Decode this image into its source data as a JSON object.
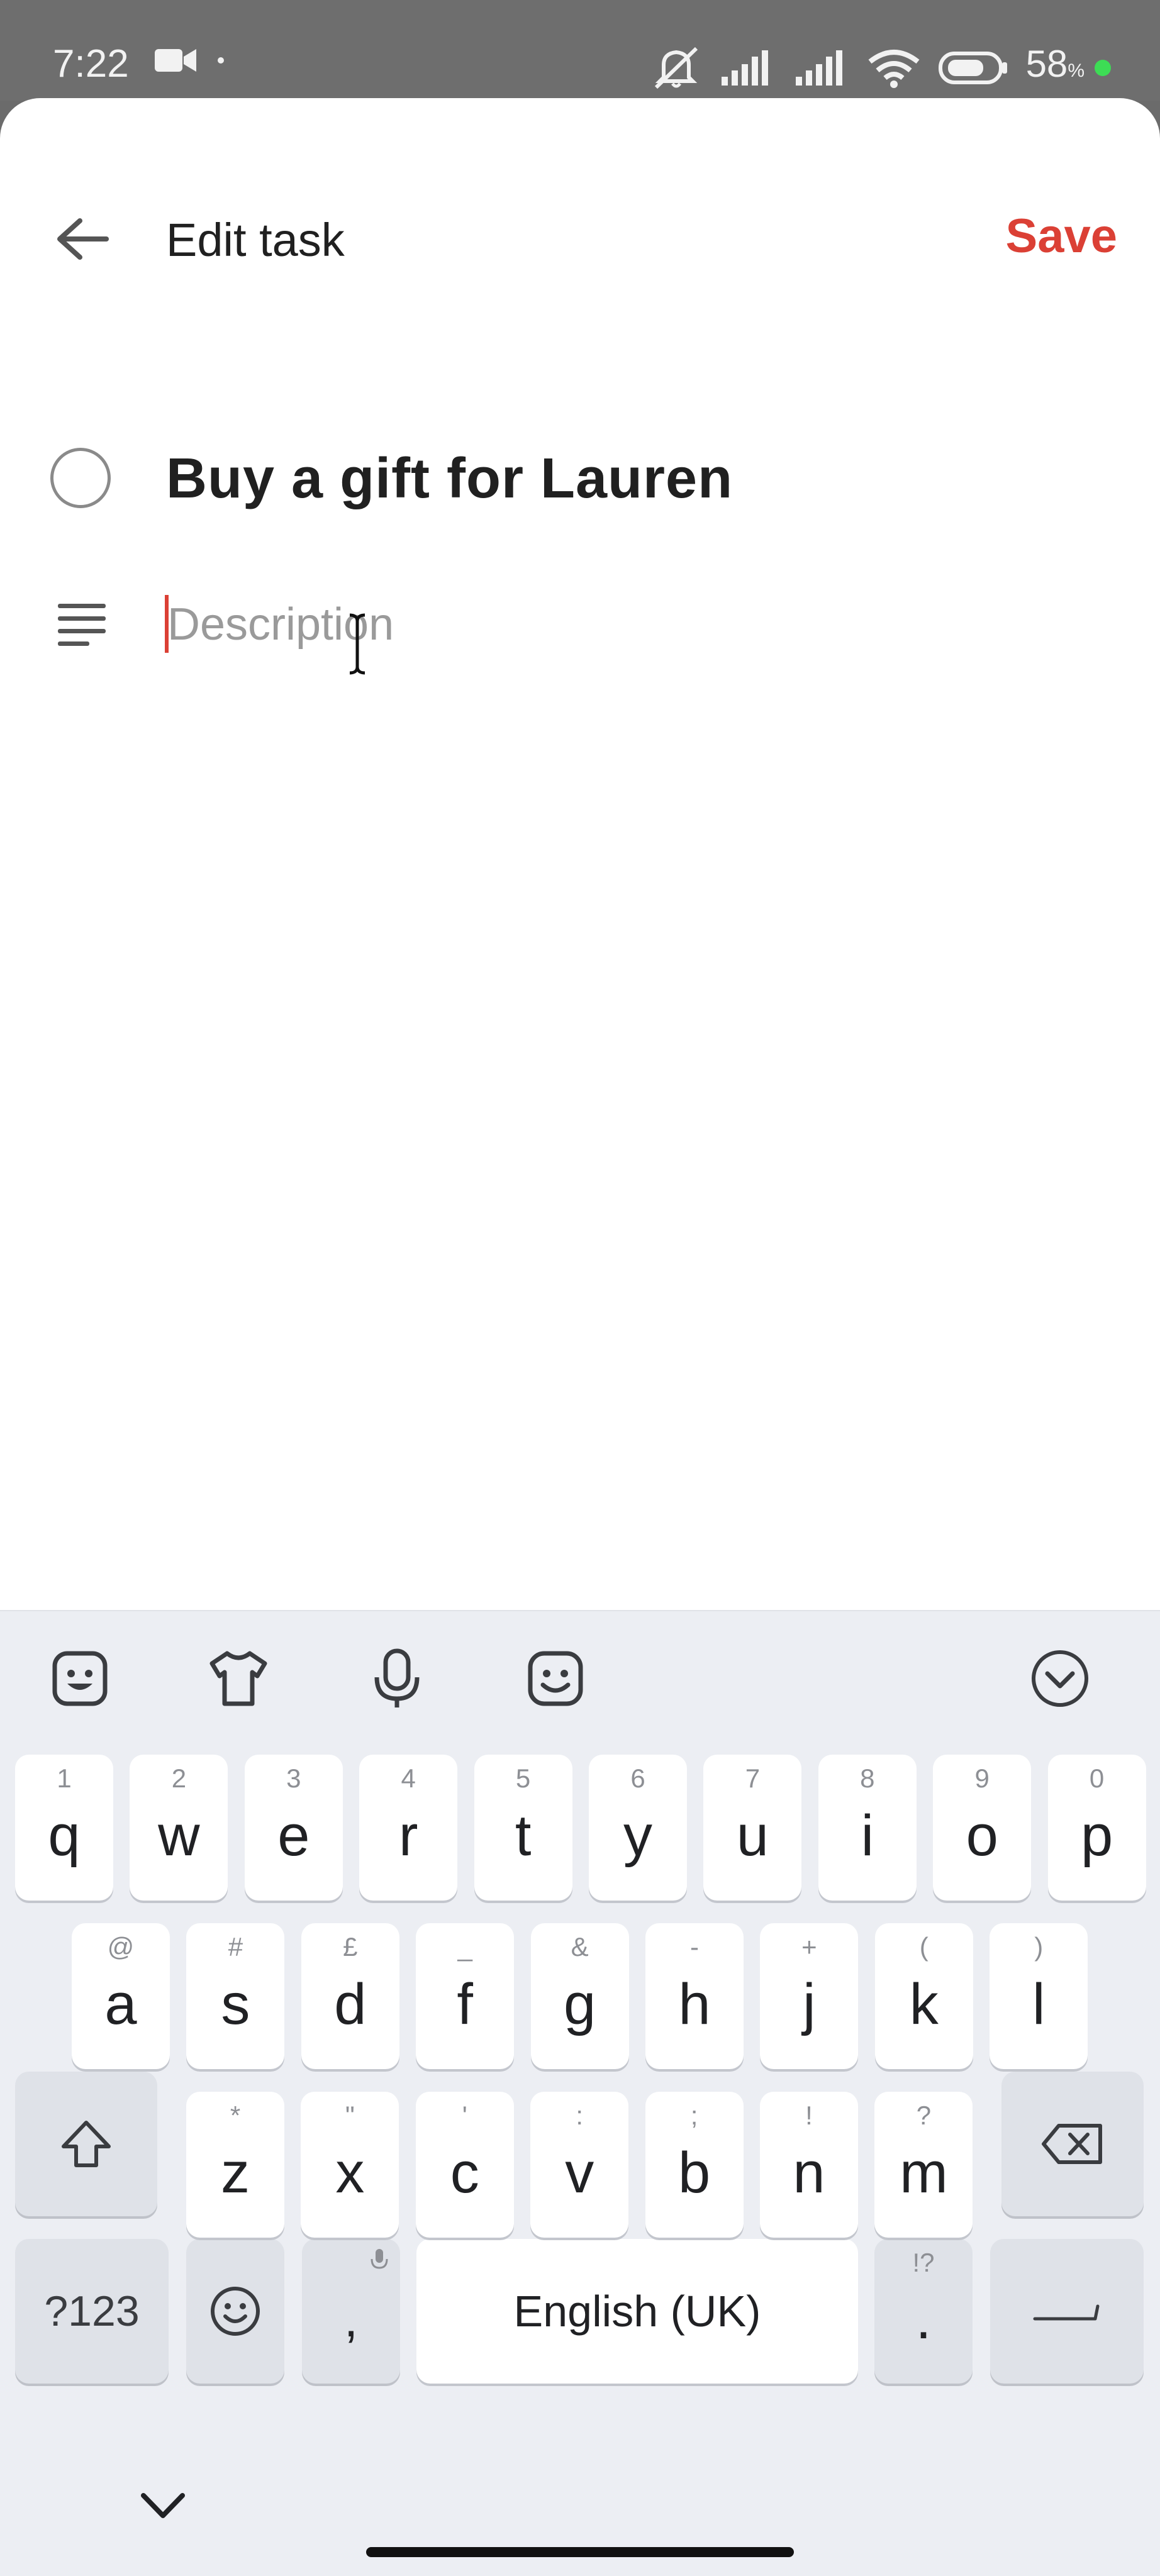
{
  "status_bar": {
    "time": "7:22",
    "battery": "58",
    "battery_unit": "%"
  },
  "header": {
    "title": "Edit task",
    "save_label": "Save"
  },
  "task": {
    "title": "Buy a gift for Lauren",
    "description_value": "",
    "description_placeholder": "Description"
  },
  "keyboard": {
    "row1": [
      {
        "key": "q",
        "hint": "1"
      },
      {
        "key": "w",
        "hint": "2"
      },
      {
        "key": "e",
        "hint": "3"
      },
      {
        "key": "r",
        "hint": "4"
      },
      {
        "key": "t",
        "hint": "5"
      },
      {
        "key": "y",
        "hint": "6"
      },
      {
        "key": "u",
        "hint": "7"
      },
      {
        "key": "i",
        "hint": "8"
      },
      {
        "key": "o",
        "hint": "9"
      },
      {
        "key": "p",
        "hint": "0"
      }
    ],
    "row2": [
      {
        "key": "a",
        "hint": "@"
      },
      {
        "key": "s",
        "hint": "#"
      },
      {
        "key": "d",
        "hint": "£"
      },
      {
        "key": "f",
        "hint": "_"
      },
      {
        "key": "g",
        "hint": "&"
      },
      {
        "key": "h",
        "hint": "-"
      },
      {
        "key": "j",
        "hint": "+"
      },
      {
        "key": "k",
        "hint": "("
      },
      {
        "key": "l",
        "hint": ")"
      }
    ],
    "row3": [
      {
        "key": "z",
        "hint": "*"
      },
      {
        "key": "x",
        "hint": "\""
      },
      {
        "key": "c",
        "hint": "'"
      },
      {
        "key": "v",
        "hint": ":"
      },
      {
        "key": "b",
        "hint": ";"
      },
      {
        "key": "n",
        "hint": "!"
      },
      {
        "key": "m",
        "hint": "?"
      }
    ],
    "symbols_label": "?123",
    "comma": ",",
    "space_label": "English (UK)",
    "period": ".",
    "period_hint": "!?"
  },
  "colors": {
    "accent": "#db4035",
    "sheet_bg": "#ffffff",
    "keyboard_bg": "#eceef3"
  }
}
